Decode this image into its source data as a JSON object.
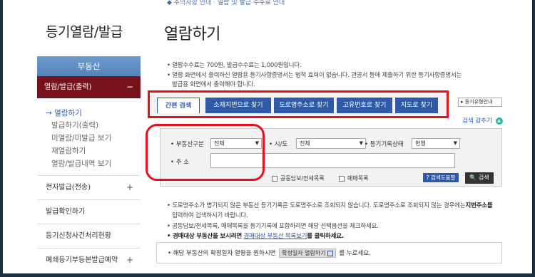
{
  "top_partial": "◆ 주의사항 안내 · 열람 및 발급 수수료 안내",
  "sidebar": {
    "title": "등기열람/발급",
    "menu_head": "부동산",
    "active_item": "열람/발급(출력)",
    "active_collapse": "−",
    "subitems": [
      "→ 열람하기",
      "발급하기(출력)",
      "미열람/미발급 보기",
      "재열람하기",
      "열람/발급내역 보기"
    ],
    "main_items": [
      {
        "label": "전자발급(전송)",
        "toggle": "+"
      },
      {
        "label": "발급확인하기",
        "toggle": ""
      },
      {
        "label": "등기신청사건처리현황",
        "toggle": ""
      },
      {
        "label": "폐쇄등기부등본발급예약",
        "toggle": "+"
      }
    ]
  },
  "main": {
    "title": "열람하기",
    "notes": [
      "• 열람수수료는 700원, 발급수수료는 1,000원입니다.",
      "• 열람 화면에서 출력하신 열람용 등기사항증명서는 법적 효력이 없습니다. 관공서 등에 제출하기 위한 등기사항증명서는",
      "발급용 화면에서 출력해야 합니다."
    ],
    "tabs": [
      "간편 검색",
      "소재지번으로 찾기",
      "도로명주소로 찾기",
      "고유번호로 찾기",
      "지도로 찾기"
    ],
    "history_btn": "▸ 등기유형안내",
    "search_close": "검색 감추기",
    "search_close_icon": "▲",
    "form": {
      "type_label": "• 부동산구분",
      "type_value": "전체",
      "sido_label": "• 시/도",
      "sido_value": "전체",
      "status_label": "• 등기기록상태",
      "status_value": "현행",
      "addr_label": "• 주 소",
      "addr_value": "",
      "check1": "공동담보/전세목록",
      "check2": "매매목록",
      "help_btn": "? 검색도움말",
      "search_btn": "🔍 검색"
    },
    "bottom_notes": [
      "• 도로명주소가 병기되지 않은 부동산 등기기록은 도로명주소로 조회되지 않습니다. 도로명주소로 조회되지 않는 경우에는",
      "지번주소를",
      "입력하여 검색하시기 바랍니다.",
      "• 공동담보/전세목록, 매매목록을 등기기록에 포함하려면 해당 선택옵션을 체크하세요.",
      "• 경매대상 부동산을 보시려면",
      "경매대상 부동산 목록보기",
      "를 클릭하세요."
    ],
    "info": {
      "prefix": "• 해당 부동산의 확정일자 열람을 원하시면",
      "button": "확정일자 열람하기",
      "suffix": "를 누르세요."
    }
  }
}
